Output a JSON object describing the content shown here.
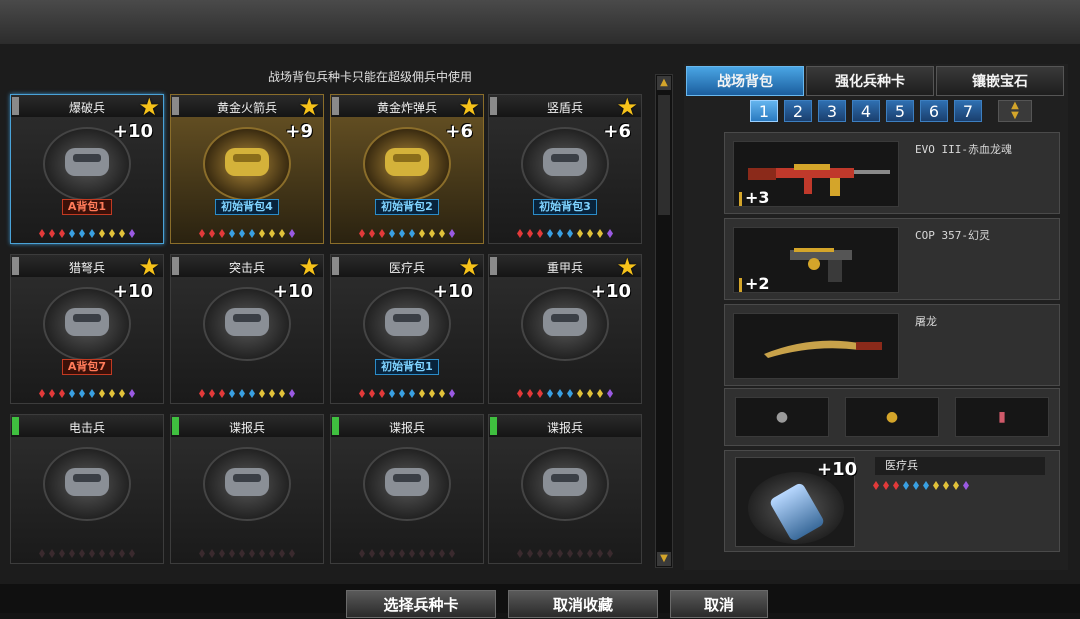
{
  "notice": "战场背包兵种卡只能在超级佣兵中使用",
  "tabs": [
    {
      "label": "战场背包",
      "active": true
    },
    {
      "label": "强化兵种卡",
      "active": false
    },
    {
      "label": "镶嵌宝石",
      "active": false
    }
  ],
  "pages": [
    "1",
    "2",
    "3",
    "4",
    "5",
    "6",
    "7"
  ],
  "cards": [
    {
      "name": "爆破兵",
      "level": "+10",
      "star": true,
      "bag": "A背包1",
      "bag_type": "a",
      "style": "selected",
      "tag": "gray",
      "gems": "full"
    },
    {
      "name": "黄金火箭兵",
      "level": "+9",
      "star": true,
      "bag": "初始背包4",
      "bag_type": "i",
      "style": "gold",
      "tag": "gray",
      "gems": "full"
    },
    {
      "name": "黄金炸弹兵",
      "level": "+6",
      "star": true,
      "bag": "初始背包2",
      "bag_type": "i",
      "style": "gold",
      "tag": "gray",
      "gems": "full"
    },
    {
      "name": "竖盾兵",
      "level": "+6",
      "star": true,
      "bag": "初始背包3",
      "bag_type": "i",
      "style": "",
      "tag": "gray",
      "gems": "full"
    },
    {
      "name": "猎弩兵",
      "level": "+10",
      "star": true,
      "bag": "A背包7",
      "bag_type": "a",
      "style": "",
      "tag": "gray",
      "gems": "full"
    },
    {
      "name": "突击兵",
      "level": "+10",
      "star": true,
      "bag": "",
      "bag_type": "",
      "style": "",
      "tag": "gray",
      "gems": "full"
    },
    {
      "name": "医疗兵",
      "level": "+10",
      "star": true,
      "bag": "初始背包1",
      "bag_type": "i",
      "style": "",
      "tag": "gray",
      "gems": "full"
    },
    {
      "name": "重甲兵",
      "level": "+10",
      "star": true,
      "bag": "",
      "bag_type": "",
      "style": "",
      "tag": "gray",
      "gems": "full"
    },
    {
      "name": "电击兵",
      "level": "",
      "star": false,
      "bag": "",
      "bag_type": "",
      "style": "",
      "tag": "green",
      "gems": "empty"
    },
    {
      "name": "谍报兵",
      "level": "",
      "star": false,
      "bag": "",
      "bag_type": "",
      "style": "",
      "tag": "green",
      "gems": "empty"
    },
    {
      "name": "谍报兵",
      "level": "",
      "star": false,
      "bag": "",
      "bag_type": "",
      "style": "",
      "tag": "green",
      "gems": "empty"
    },
    {
      "name": "谍报兵",
      "level": "",
      "star": false,
      "bag": "",
      "bag_type": "",
      "style": "",
      "tag": "green",
      "gems": "empty"
    }
  ],
  "gem_colors": [
    "#e23a3a",
    "#e23a3a",
    "#e23a3a",
    "#3aa0e2",
    "#3aa0e2",
    "#3aa0e2",
    "#e2c23a",
    "#e2c23a",
    "#e2c23a",
    "#9a5ae2"
  ],
  "weapons": [
    {
      "name": "EVO III-赤血龙魂",
      "plus": "+3"
    },
    {
      "name": "COP 357-幻灵",
      "plus": "+2"
    },
    {
      "name": "屠龙",
      "plus": ""
    }
  ],
  "equipped_card": {
    "name": "医疗兵",
    "level": "+10"
  },
  "buttons": {
    "select": "选择兵种卡",
    "unfavorite": "取消收藏",
    "cancel": "取消"
  }
}
